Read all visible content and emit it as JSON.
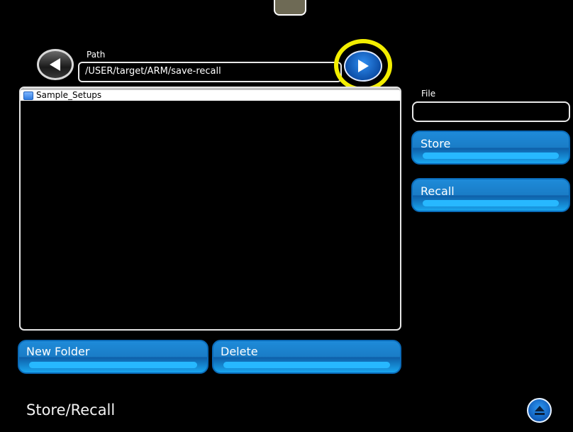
{
  "path": {
    "label": "Path",
    "value": "/USER/target/ARM/save-recall"
  },
  "browser": {
    "items": [
      {
        "label": "Sample_Setups",
        "icon": "folder-icon",
        "selected": true
      }
    ]
  },
  "file": {
    "label": "File",
    "value": ""
  },
  "buttons": {
    "store": "Store",
    "recall": "Recall",
    "new_folder": "New Folder",
    "delete": "Delete"
  },
  "page": {
    "title": "Store/Recall"
  },
  "colors": {
    "highlight": "#f3ee00",
    "button_blue": "#1a7cc6",
    "background": "#000000"
  }
}
